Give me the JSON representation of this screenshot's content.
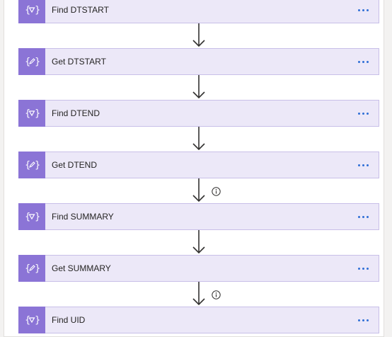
{
  "flow": {
    "steps": [
      {
        "title": "Find DTSTART",
        "icon": "find-variable-icon"
      },
      {
        "title": "Get DTSTART",
        "icon": "edit-variable-icon"
      },
      {
        "title": "Find DTEND",
        "icon": "find-variable-icon"
      },
      {
        "title": "Get DTEND",
        "icon": "edit-variable-icon"
      },
      {
        "title": "Find SUMMARY",
        "icon": "find-variable-icon"
      },
      {
        "title": "Get SUMMARY",
        "icon": "edit-variable-icon"
      },
      {
        "title": "Find UID",
        "icon": "find-variable-icon"
      }
    ],
    "more_icon": "ellipsis-icon",
    "connector_icon": "down-arrow-icon",
    "info_icon": "info-icon"
  },
  "colors": {
    "card_background": "#ece8f8",
    "card_border": "#c8bfe8",
    "icon_tile": "#8b74d6",
    "more_dots": "#2f6fd6",
    "arrow": "#323130"
  }
}
